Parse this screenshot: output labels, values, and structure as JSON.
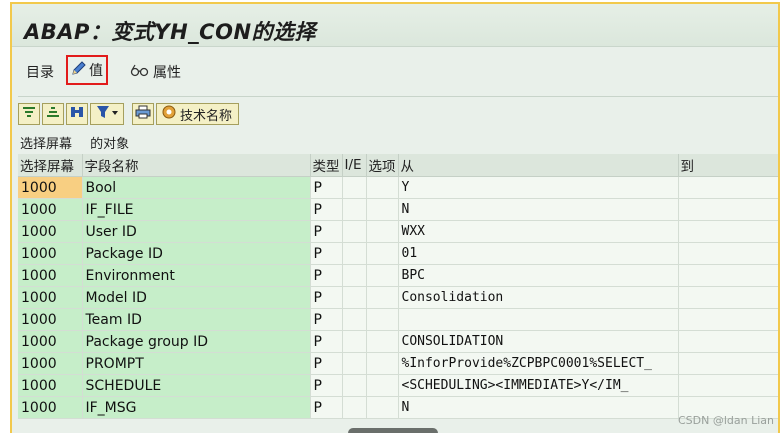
{
  "window": {
    "title": "ABAP：变式YH_CON的选择"
  },
  "menu": {
    "directory_label": "目录",
    "value_label": "值",
    "attributes_label": "属性"
  },
  "toolbar": {
    "tech_name_label": "技术名称"
  },
  "caption": {
    "left": "选择屏幕",
    "right": "的对象"
  },
  "table": {
    "columns": [
      "选择屏幕",
      "字段名称",
      "类型",
      "I/E",
      "选项",
      "从",
      "到"
    ],
    "rows": [
      {
        "screen": "1000",
        "field": "Bool",
        "type": "P",
        "ie": "",
        "option": "",
        "from": "Y",
        "to": ""
      },
      {
        "screen": "1000",
        "field": "IF_FILE",
        "type": "P",
        "ie": "",
        "option": "",
        "from": "N",
        "to": ""
      },
      {
        "screen": "1000",
        "field": "User ID",
        "type": "P",
        "ie": "",
        "option": "",
        "from": "WXX",
        "to": ""
      },
      {
        "screen": "1000",
        "field": "Package ID",
        "type": "P",
        "ie": "",
        "option": "",
        "from": "01",
        "to": ""
      },
      {
        "screen": "1000",
        "field": "Environment",
        "type": "P",
        "ie": "",
        "option": "",
        "from": "BPC",
        "to": ""
      },
      {
        "screen": "1000",
        "field": "Model ID",
        "type": "P",
        "ie": "",
        "option": "",
        "from": "Consolidation",
        "to": ""
      },
      {
        "screen": "1000",
        "field": "Team ID",
        "type": "P",
        "ie": "",
        "option": "",
        "from": "",
        "to": ""
      },
      {
        "screen": "1000",
        "field": "Package group ID",
        "type": "P",
        "ie": "",
        "option": "",
        "from": "CONSOLIDATION",
        "to": ""
      },
      {
        "screen": "1000",
        "field": "PROMPT",
        "type": "P",
        "ie": "",
        "option": "",
        "from": "%InforProvide%ZCPBPC0001%SELECT_",
        "to": ""
      },
      {
        "screen": "1000",
        "field": "SCHEDULE",
        "type": "P",
        "ie": "",
        "option": "",
        "from": "<SCHEDULING><IMMEDIATE>Y</IM_",
        "to": ""
      },
      {
        "screen": "1000",
        "field": "IF_MSG",
        "type": "P",
        "ie": "",
        "option": "",
        "from": "N",
        "to": ""
      }
    ]
  },
  "watermark": "CSDN @ldan Lian",
  "colors": {
    "key_cell_bg": "#c6eec9",
    "selected_cell_bg": "#f8cf82",
    "highlight_border": "#e21b1b"
  }
}
